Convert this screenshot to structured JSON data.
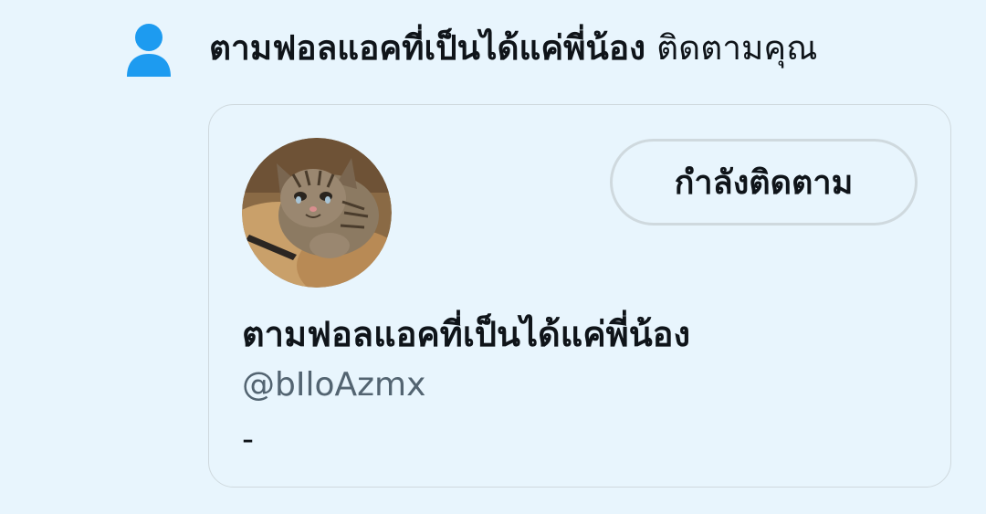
{
  "notification": {
    "icon": "person-icon",
    "actor_name": "ตามฟอลแอคที่เป็นได้แค่พี่น้อง",
    "action_text": "ติดตามคุณ"
  },
  "user_card": {
    "display_name": "ตามฟอลแอคที่เป็นได้แค่พี่น้อง",
    "handle": "@bIloAzmx",
    "bio": "-",
    "follow_button_label": "กำลังติดตาม",
    "avatar_description": "crying-cat-avatar"
  },
  "colors": {
    "background": "#e8f5fd",
    "icon_blue": "#1d9bf0",
    "text_primary": "#0f1419",
    "text_secondary": "#536471",
    "border": "#cfd9de"
  }
}
